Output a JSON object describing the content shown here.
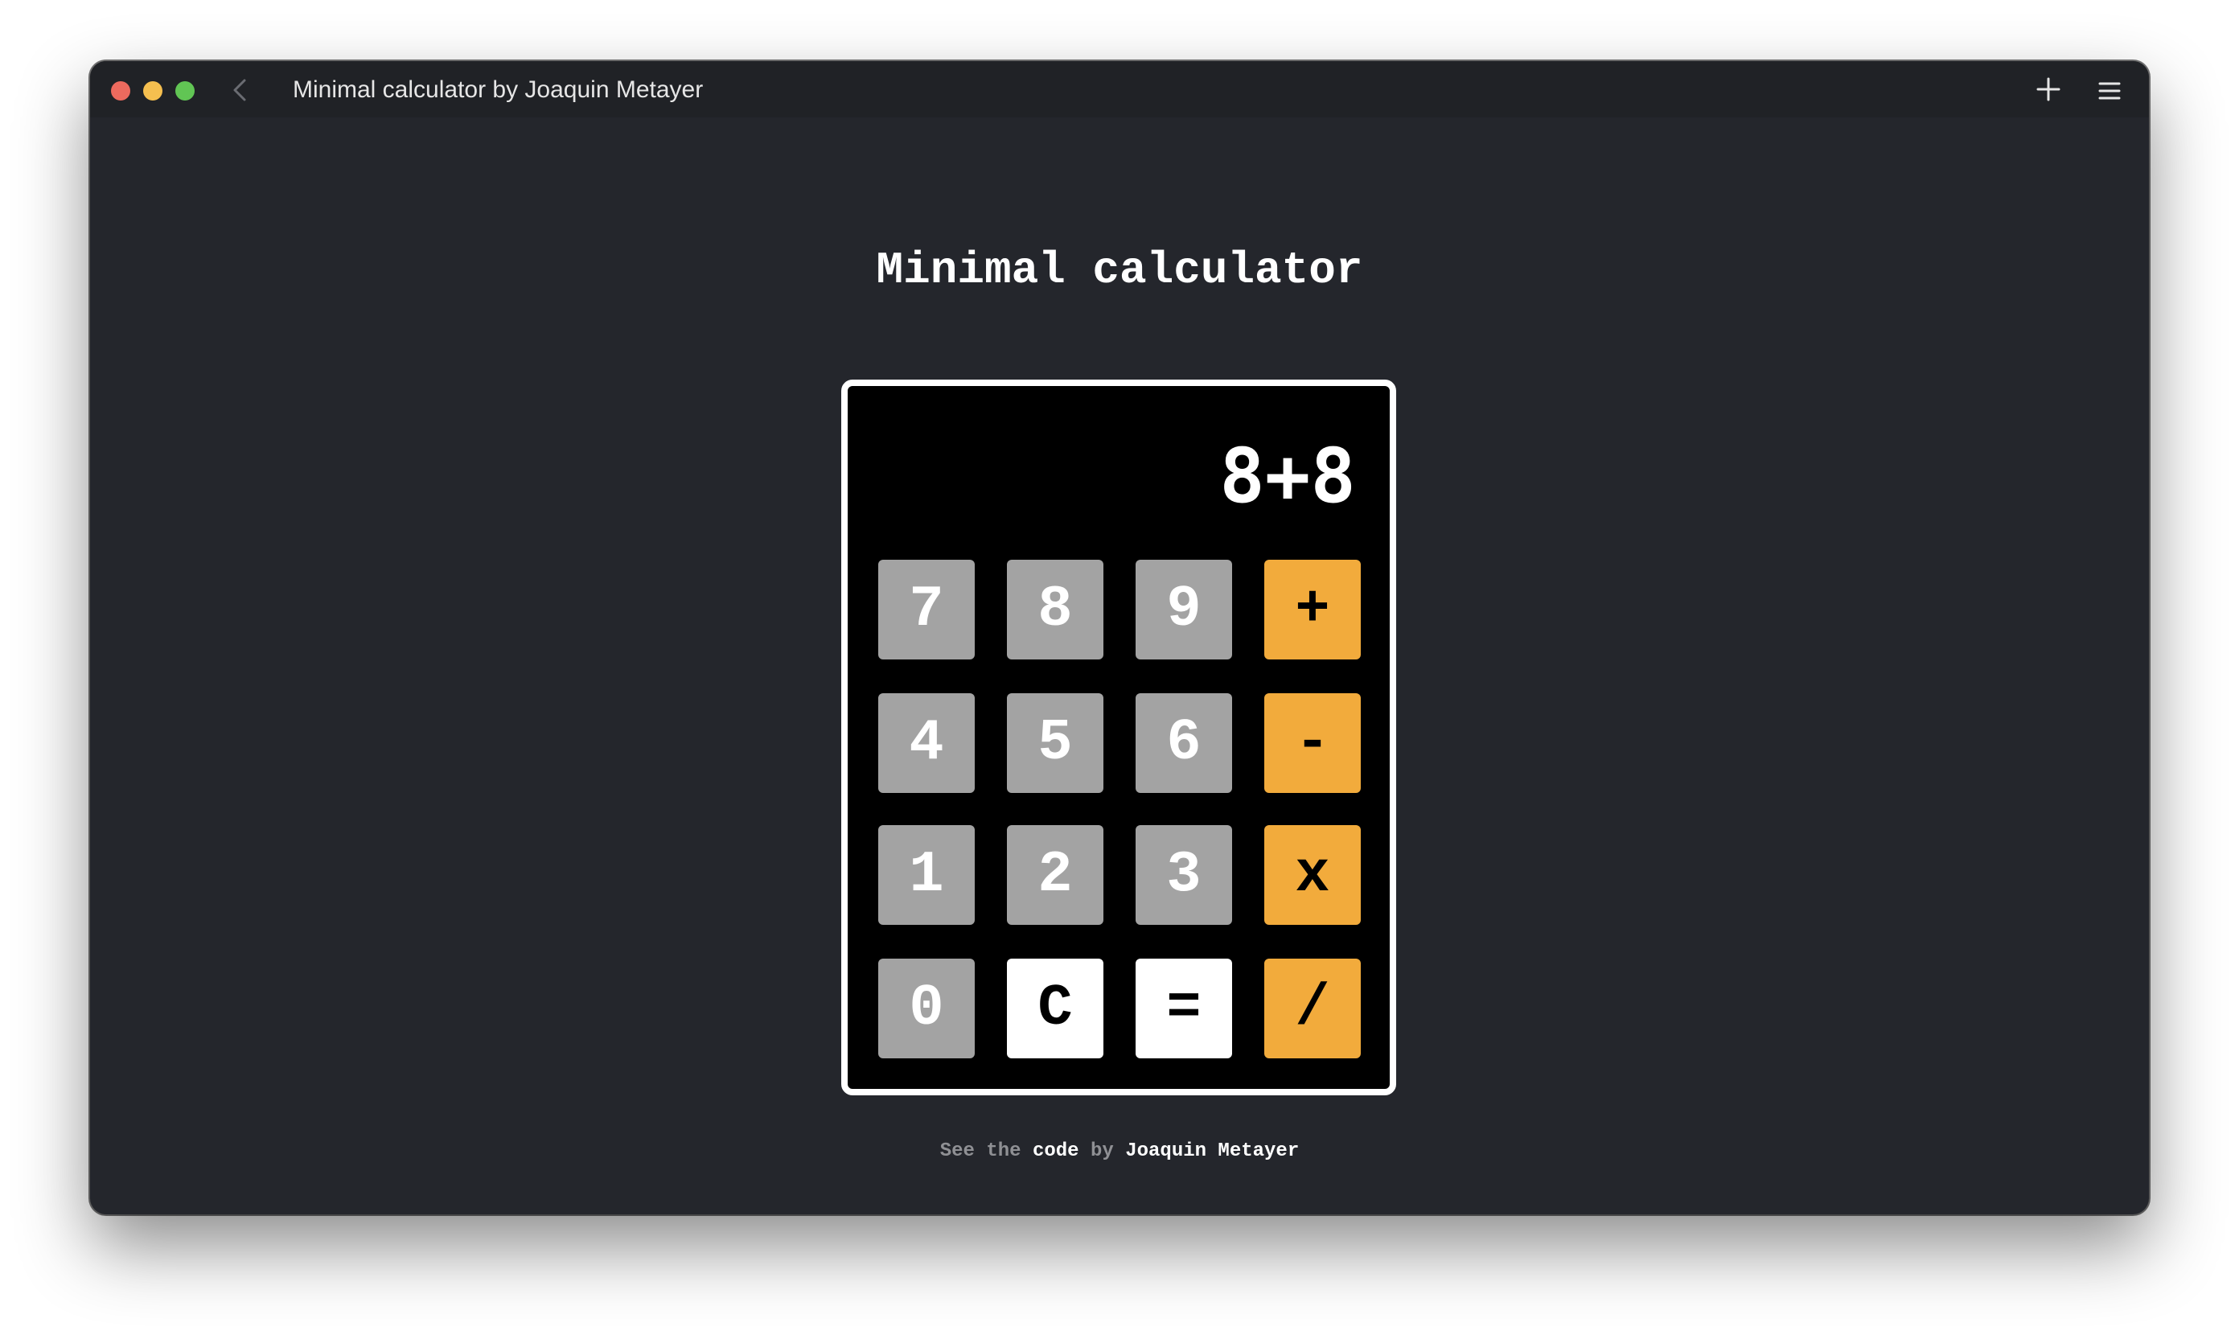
{
  "window": {
    "title": "Minimal calculator by Joaquin Metayer",
    "buttons": [
      "close",
      "minimize",
      "maximize"
    ],
    "icons": {
      "back": "chevron-left-icon",
      "new_tab": "plus-icon",
      "menu": "hamburger-menu-icon"
    }
  },
  "app": {
    "title": "Minimal calculator",
    "display": "8+8",
    "keys": [
      {
        "label": "7",
        "kind": "num"
      },
      {
        "label": "8",
        "kind": "num"
      },
      {
        "label": "9",
        "kind": "num"
      },
      {
        "label": "+",
        "kind": "op"
      },
      {
        "label": "4",
        "kind": "num"
      },
      {
        "label": "5",
        "kind": "num"
      },
      {
        "label": "6",
        "kind": "num"
      },
      {
        "label": "-",
        "kind": "op"
      },
      {
        "label": "1",
        "kind": "num"
      },
      {
        "label": "2",
        "kind": "num"
      },
      {
        "label": "3",
        "kind": "num"
      },
      {
        "label": "x",
        "kind": "op"
      },
      {
        "label": "0",
        "kind": "num"
      },
      {
        "label": "C",
        "kind": "light"
      },
      {
        "label": "=",
        "kind": "light"
      },
      {
        "label": "/",
        "kind": "op"
      }
    ]
  },
  "footer": {
    "prefix": "See the",
    "code_link": "code",
    "by": "by",
    "author_link": "Joaquin Metayer"
  },
  "colors": {
    "window_bg": "#24262c",
    "titlebar_bg": "#202226",
    "traffic_red": "#ed6a5e",
    "traffic_yellow": "#f5bf4f",
    "traffic_green": "#61c554",
    "number_key": "#a3a3a3",
    "operator_key": "#f2ab3c",
    "light_key": "#ffffff",
    "calculator_bg": "#000000"
  }
}
